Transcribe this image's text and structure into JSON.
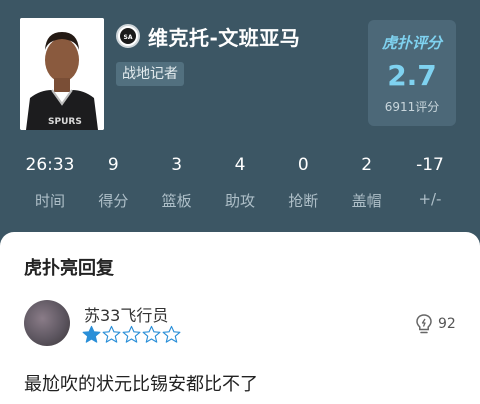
{
  "player": {
    "name": "维克托-文班亚马",
    "role": "战地记者"
  },
  "rating": {
    "title": "虎扑评分",
    "score": "2.7",
    "count": "6911评分"
  },
  "stats": [
    {
      "value": "26:33",
      "label": "时间"
    },
    {
      "value": "9",
      "label": "得分"
    },
    {
      "value": "3",
      "label": "篮板"
    },
    {
      "value": "4",
      "label": "助攻"
    },
    {
      "value": "0",
      "label": "抢断"
    },
    {
      "value": "2",
      "label": "盖帽"
    },
    {
      "value": "-17",
      "label": "+/-"
    }
  ],
  "reply_sheet": {
    "title": "虎扑亮回复",
    "comment": {
      "user": "苏33飞行员",
      "stars_total": 5,
      "stars_filled": 1,
      "likes": "92",
      "text": "最尬吹的状元比锡安都比不了"
    }
  },
  "colors": {
    "header_bg": "#3c5664",
    "accent": "#7fd2f0",
    "star_blue": "#2a8fd8"
  }
}
